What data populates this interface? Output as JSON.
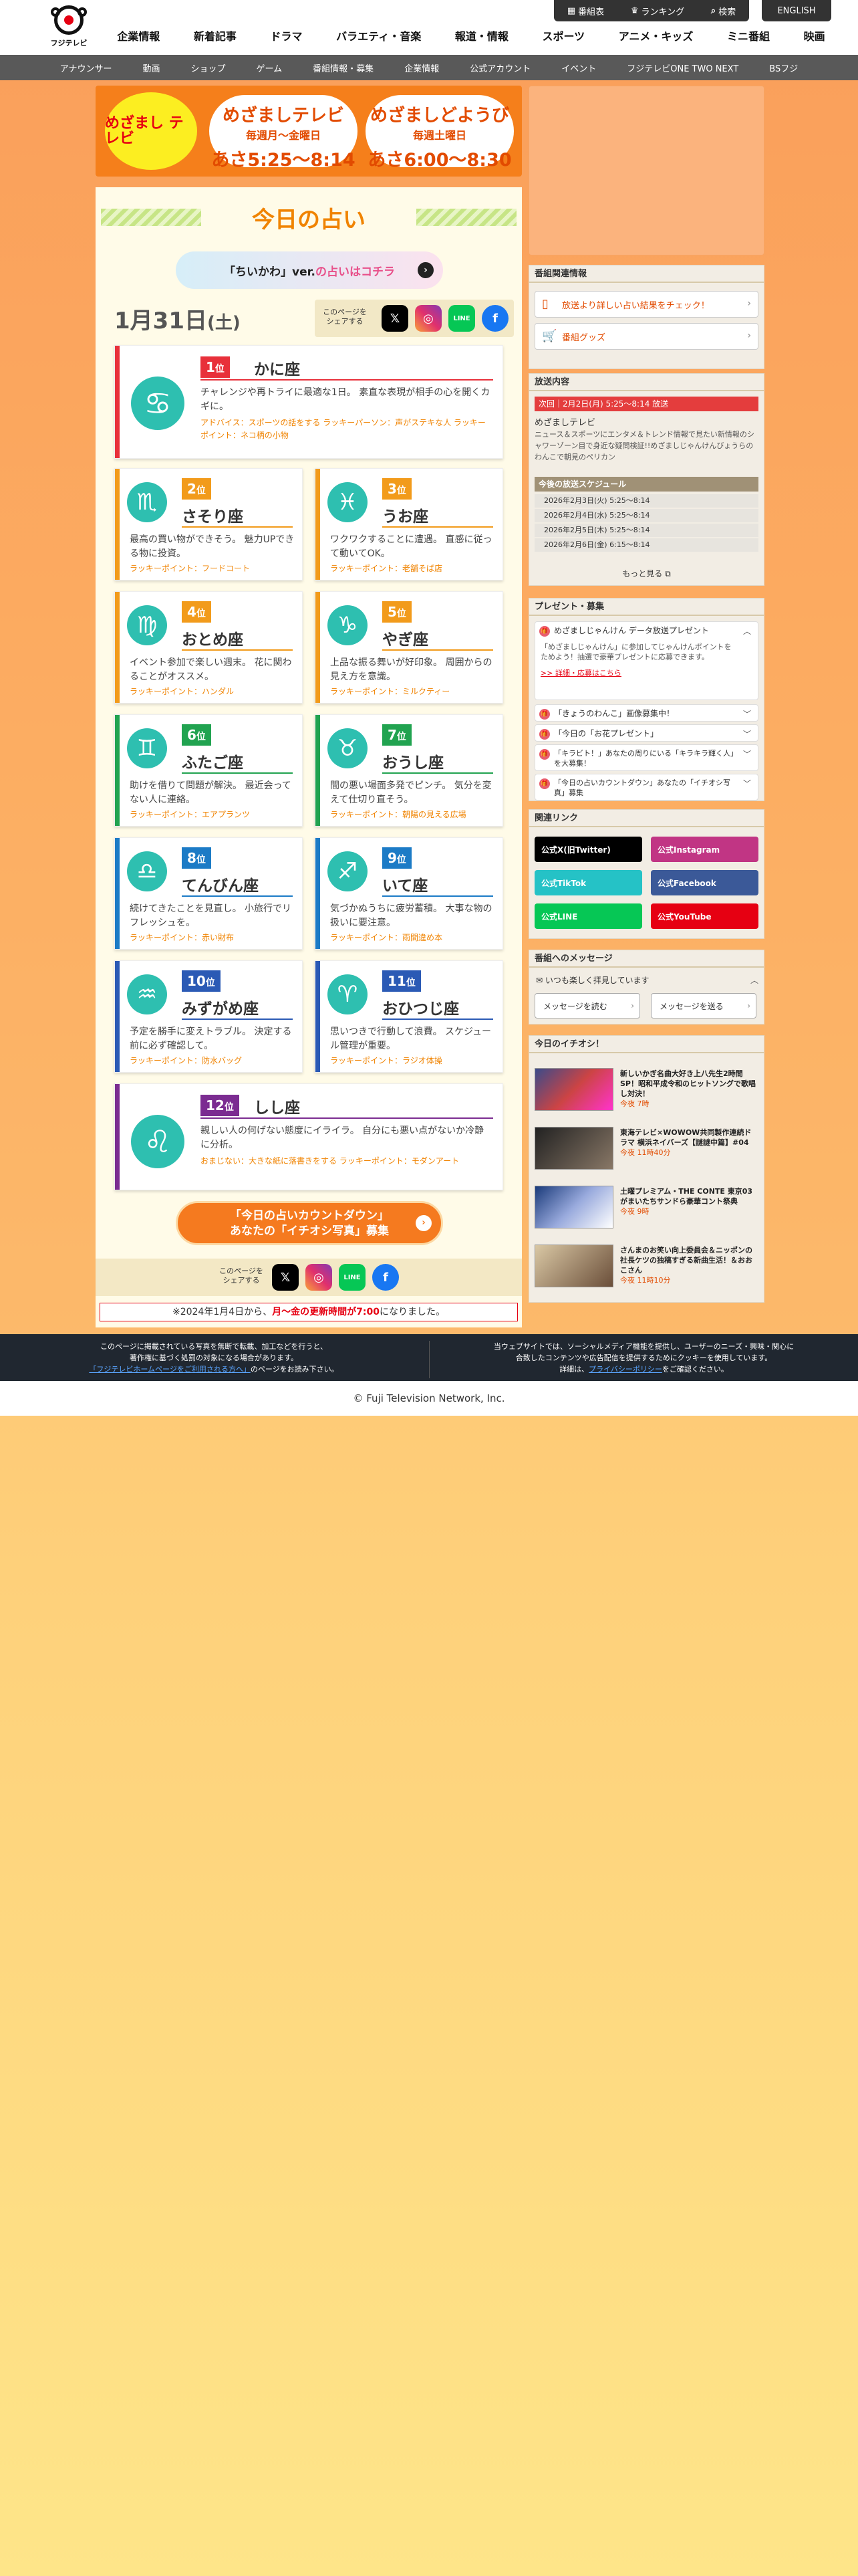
{
  "header": {
    "logo_text": "フジテレビ",
    "util": [
      "番組表",
      "ランキング",
      "検索"
    ],
    "english": "ENGLISH",
    "nav": [
      "企業情報",
      "新着記事",
      "ドラマ",
      "バラエティ・音楽",
      "報道・情報",
      "スポーツ",
      "アニメ・キッズ",
      "ミニ番組",
      "映画"
    ],
    "subnav": [
      "アナウンサー",
      "動画",
      "ショップ",
      "ゲーム",
      "番組情報・募集",
      "企業情報",
      "公式アカウント",
      "イベント",
      "フジテレビONE TWO NEXT",
      "BSフジ"
    ]
  },
  "banner": {
    "logo": "めざまし テレビ",
    "pill1": {
      "t1": "めざましテレビ",
      "t2": "毎週月〜金曜日",
      "t3": "あさ5:25〜8:14"
    },
    "pill2": {
      "t1": "めざましどようび",
      "t2": "毎週土曜日",
      "t3": "あさ6:00〜8:30"
    }
  },
  "main": {
    "title": "今日の占い",
    "chiikawa_a": "「ちいかわ」ver.",
    "chiikawa_b": "の占いはコチラ",
    "date_num": "1月31日",
    "date_dow": "(土)",
    "share_label": "このページを シェアする",
    "cards": [
      {
        "rank": "1",
        "sign": "かに座",
        "glyph": "♋",
        "desc": "チャレンジや再トライに最適な1日。 素直な表現が相手の心を開くカギに。",
        "lucky": "アドバイス：スポーツの話をする ラッキーパーソン：声がステキな人 ラッキーポイント：ネコ柄の小物"
      },
      {
        "rank": "2",
        "sign": "さそり座",
        "glyph": "♏",
        "desc": "最高の買い物ができそう。 魅力UPできる物に投資。",
        "lucky": "ラッキーポイント：フードコート"
      },
      {
        "rank": "3",
        "sign": "うお座",
        "glyph": "♓",
        "desc": "ワクワクすることに遭遇。 直感に従って動いてOK。",
        "lucky": "ラッキーポイント：老舗そば店"
      },
      {
        "rank": "4",
        "sign": "おとめ座",
        "glyph": "♍",
        "desc": "イベント参加で楽しい週末。 花に関わることがオススメ。",
        "lucky": "ラッキーポイント：ハンダル"
      },
      {
        "rank": "5",
        "sign": "やぎ座",
        "glyph": "♑",
        "desc": "上品な振る舞いが好印象。 周囲からの見え方を意識。",
        "lucky": "ラッキーポイント：ミルクティー"
      },
      {
        "rank": "6",
        "sign": "ふたご座",
        "glyph": "♊",
        "desc": "助けを借りて問題が解決。 最近会ってない人に連絡。",
        "lucky": "ラッキーポイント：エアプランツ"
      },
      {
        "rank": "7",
        "sign": "おうし座",
        "glyph": "♉",
        "desc": "間の悪い場面多発でピンチ。 気分を変えて仕切り直そう。",
        "lucky": "ラッキーポイント：朝陽の見える広場"
      },
      {
        "rank": "8",
        "sign": "てんびん座",
        "glyph": "♎",
        "desc": "続けてきたことを見直し。 小旅行でリフレッシュを。",
        "lucky": "ラッキーポイント：赤い財布"
      },
      {
        "rank": "9",
        "sign": "いて座",
        "glyph": "♐",
        "desc": "気づかぬうちに疲労蓄積。 大事な物の扱いに要注意。",
        "lucky": "ラッキーポイント：雨間違め本"
      },
      {
        "rank": "10",
        "sign": "みずがめ座",
        "glyph": "♒",
        "desc": "予定を勝手に変えトラブル。 決定する前に必ず確認して。",
        "lucky": "ラッキーポイント：防水バッグ"
      },
      {
        "rank": "11",
        "sign": "おひつじ座",
        "glyph": "♈",
        "desc": "思いつきで行動して浪費。 スケジュール管理が重要。",
        "lucky": "ラッキーポイント：ラジオ体操"
      },
      {
        "rank": "12",
        "sign": "しし座",
        "glyph": "♌",
        "desc": "親しい人の何げない態度にイライラ。 自分にも悪い点がないか冷静に分析。",
        "lucky": "おまじない：大きな紙に落書きをする ラッキーポイント：モダンアート"
      }
    ],
    "rank_suffix": "位",
    "big_button": {
      "l1": "「今日の占いカウントダウン」",
      "l2": "あなたの「イチオシ写真」募集"
    },
    "note_pre": "※2024年1月4日から、",
    "note_em": "月〜金の更新時間が7:00",
    "note_post": "になりました。"
  },
  "side": {
    "program_header": "番組関連情報",
    "program_links": [
      "放送より詳しい占い結果をチェック！",
      "番組グッズ"
    ],
    "broadcast_header": "放送内容",
    "bc_next": "次回｜2月2日(月) 5:25〜8:14 放送",
    "bc_title": "めざましテレビ",
    "bc_desc": "ニュース＆スポーツにエンタメ＆トレンド情報で見たい新情報のシャワーゾーン目で身近な疑問検証!!めざましじゃんけんびょうらのわんこで朝見のペリカン",
    "bc_sched": "今後の放送スケジュール",
    "bc_rows": [
      "2026年2月3日(火) 5:25〜8:14",
      "2026年2月4日(水) 5:25〜8:14",
      "2026年2月5日(木) 5:25〜8:14",
      "2026年2月6日(金) 6:15〜8:14"
    ],
    "more": "もっと見る",
    "present_header": "プレゼント・募集",
    "pr1_title": "めざましじゃんけん データ放送プレゼント",
    "pr1_body": "「めざましじゃんけん」に参加してじゃんけんポイントをためよう！抽選で豪華プレゼントに応募できます。",
    "pr1_link": ">> 詳細・応募はこちら",
    "pr_items": [
      "「きょうのわんこ」画像募集中！",
      "「今日の「お花プレゼント」",
      "「キラビト！」あなたの周りにいる「キラキラ輝く人」を大募集！",
      "「今日の占いカウントダウン」あなたの「イチオシ写真」募集"
    ],
    "links_header": "関連リンク",
    "sns": [
      "公式X(旧Twitter)",
      "公式Instagram",
      "公式TikTok",
      "公式Facebook",
      "公式LINE",
      "公式YouTube"
    ],
    "message_header": "番組へのメッセージ",
    "message_title": "いつも楽しく拝見しています",
    "msg_read": "メッセージを読む",
    "msg_send": "メッセージを送る",
    "pick_header": "今日のイチオシ！",
    "picks": [
      {
        "t": "新しいかぎ名曲大好き上八先生2時間SP！昭和平成令和のヒットソングで歌唱し対決！",
        "d": "今夜 7時"
      },
      {
        "t": "東海テレビ×WOWOW共同製作連続ドラマ 横浜ネイバーズ【謎謎中篇】#04",
        "d": "今夜 11時40分"
      },
      {
        "t": "土曜プレミアム・THE CONTE 東京03がまいたちサンドら豪華コント祭典",
        "d": "今夜 9時"
      },
      {
        "t": "さんまのお笑い向上委員会＆ニッポンの社長ケツの独稿すぎる新曲生活！＆おおこさん",
        "d": "今夜 11時10分"
      }
    ]
  },
  "footer": {
    "left1": "このページに掲載されている写真を無断で転載、加工などを行うと、",
    "left2": "著作権に基づく処罰の対象になる場合があります。",
    "left3_link": "「フジテレビホームページをご利用される方へ」",
    "left3_post": "のページをお読み下さい。",
    "right1": "当ウェブサイトでは、ソーシャルメディア機能を提供し、ユーザーのニーズ・興味・関心に",
    "right2": "合致したコンテンツや広告配信を提供するためにクッキーを使用しています。",
    "right3_pre": "詳細は、",
    "right3_link": "プライバシーポリシー",
    "right3_post": "をご確認ください。",
    "copyright": "© Fuji Television Network, Inc."
  }
}
